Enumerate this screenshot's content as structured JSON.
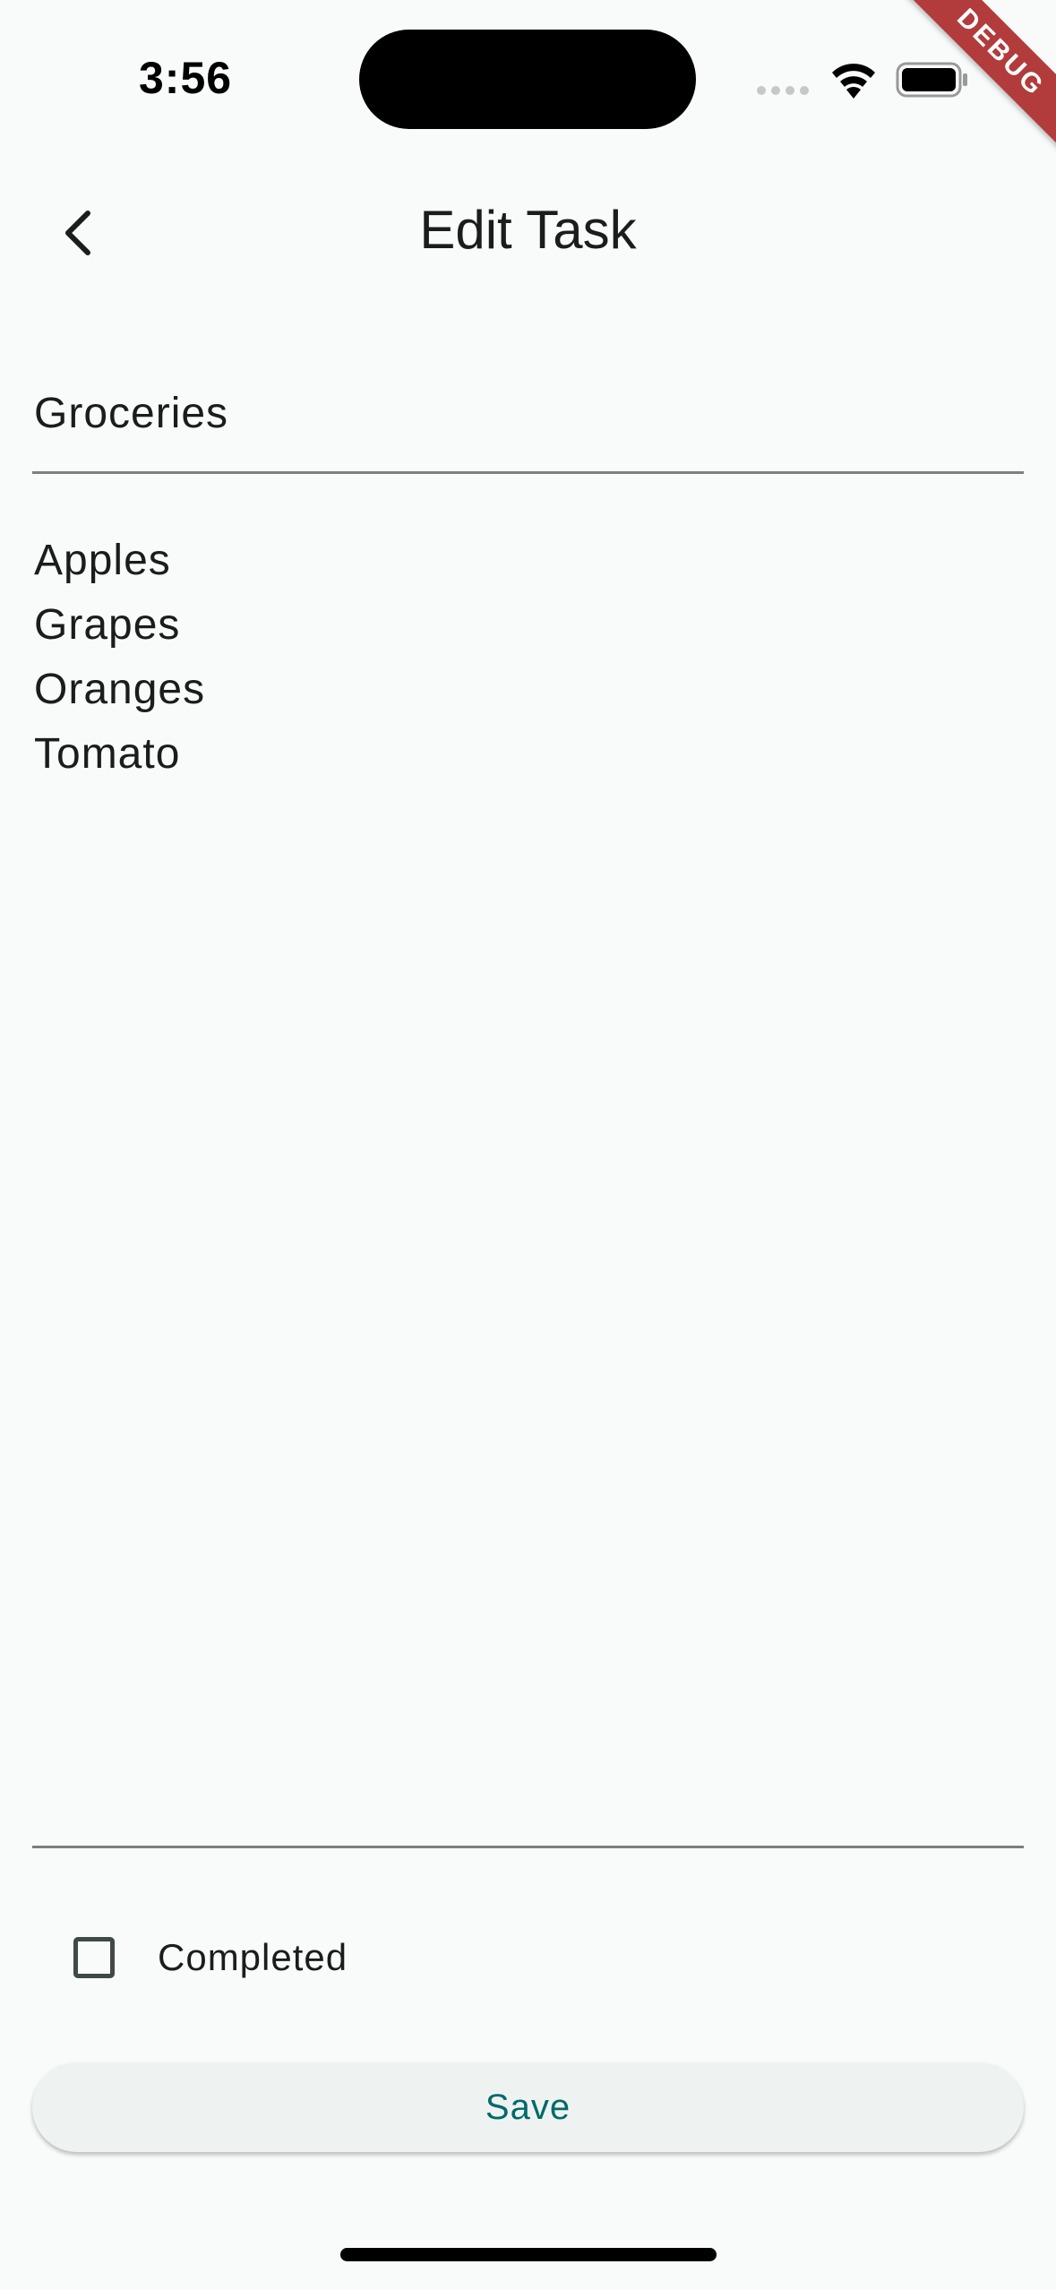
{
  "status_bar": {
    "time": "3:56",
    "icons": [
      "cellular-dots-icon",
      "wifi-icon",
      "battery-icon"
    ]
  },
  "debug_banner": {
    "label": "DEBUG",
    "color": "#b23b3b"
  },
  "app_bar": {
    "back_icon": "chevron-left-icon",
    "title": "Edit Task"
  },
  "form": {
    "title_value": "Groceries",
    "notes_lines": [
      "Apples",
      "Grapes",
      "Oranges",
      "Tomato"
    ],
    "completed_label": "Completed",
    "completed_checked": false
  },
  "actions": {
    "save_label": "Save"
  },
  "colors": {
    "background": "#f9fbfb",
    "accent": "#006a68",
    "button_background": "#eef3f2",
    "divider": "#7b7f80"
  }
}
